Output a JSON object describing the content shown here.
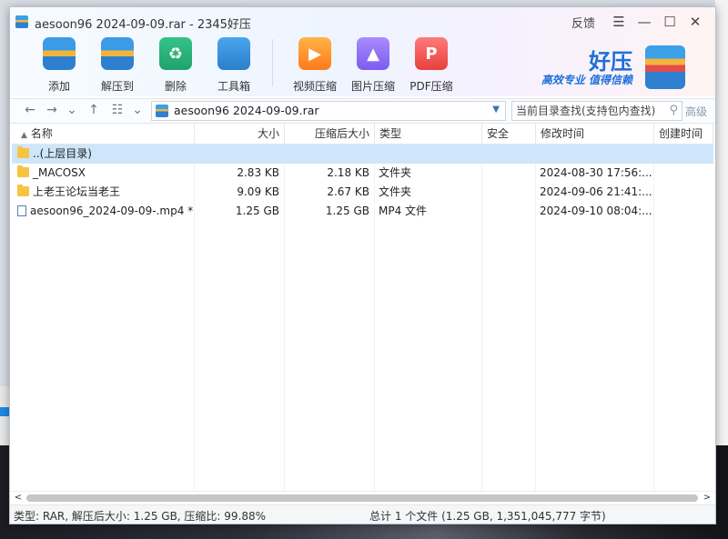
{
  "window": {
    "title": "aesoon96 2024-09-09.rar - 2345好压",
    "feedback_label": "反馈",
    "menu_icon": "☰",
    "minimize_icon": "—",
    "maximize_icon": "☐",
    "close_icon": "✕"
  },
  "toolbar": {
    "add": "添加",
    "extract": "解压到",
    "delete": "删除",
    "toolbox": "工具箱",
    "video_compress": "视频压缩",
    "image_compress": "图片压缩",
    "pdf_compress": "PDF压缩"
  },
  "brand": {
    "name": "好压",
    "slogan": "高效专业 值得信赖"
  },
  "navbar": {
    "path": "aesoon96 2024-09-09.rar",
    "search_placeholder": "当前目录查找(支持包内查找)",
    "advanced": "高级"
  },
  "table": {
    "columns": [
      "名称",
      "大小",
      "压缩后大小",
      "类型",
      "安全",
      "修改时间",
      "创建时间"
    ],
    "rows": [
      {
        "name": "..(上层目录)",
        "size": "",
        "packed": "",
        "type": "",
        "security": "",
        "modified": "",
        "created": ""
      },
      {
        "name": "_MACOSX",
        "size": "2.83 KB",
        "packed": "2.18 KB",
        "type": "文件夹",
        "security": "",
        "modified": "2024-08-30 17:56:...",
        "created": ""
      },
      {
        "name": "上老王论坛当老王",
        "size": "9.09 KB",
        "packed": "2.67 KB",
        "type": "文件夹",
        "security": "",
        "modified": "2024-09-06 21:41:...",
        "created": ""
      },
      {
        "name": "aesoon96_2024-09-09-.mp4 *",
        "size": "1.25 GB",
        "packed": "1.25 GB",
        "type": "MP4 文件",
        "security": "",
        "modified": "2024-09-10 08:04:...",
        "created": ""
      }
    ]
  },
  "status": {
    "left": "类型: RAR, 解压后大小: 1.25 GB, 压缩比: 99.88%",
    "right": "总计 1 个文件 (1.25 GB, 1,351,045,777 字节)"
  },
  "colors": {
    "accent": "#1e6fd9",
    "selected_row": "#cde6fb",
    "folder": "#f5c542"
  }
}
